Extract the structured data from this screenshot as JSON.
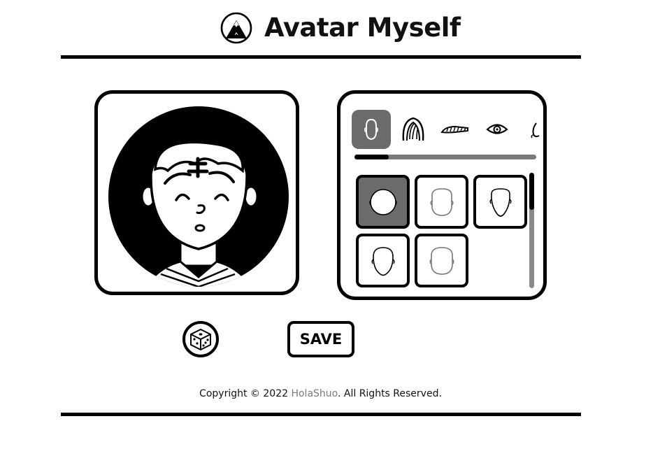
{
  "header": {
    "title": "Avatar Myself",
    "logo_icon": "mountain-logo-icon"
  },
  "avatar_preview": {
    "hair_color": "#000000",
    "face_icon": "avatar-face-icon"
  },
  "editor": {
    "categories": [
      {
        "name": "face",
        "icon": "face-shape-icon",
        "active": true
      },
      {
        "name": "hair",
        "icon": "hair-icon",
        "active": false
      },
      {
        "name": "eyebrows",
        "icon": "eyebrows-icon",
        "active": false
      },
      {
        "name": "eyes",
        "icon": "eye-icon",
        "active": false
      },
      {
        "name": "nose",
        "icon": "nose-icon",
        "active": false
      }
    ],
    "category_scroll_fraction": 0.19,
    "options": [
      {
        "name": "face-1",
        "selected": true
      },
      {
        "name": "face-2",
        "selected": false
      },
      {
        "name": "face-3",
        "selected": false
      },
      {
        "name": "face-4",
        "selected": false
      },
      {
        "name": "face-5",
        "selected": false
      }
    ],
    "options_scroll_fraction": 0.32
  },
  "actions": {
    "randomize_icon": "dice-icon",
    "save_label": "SAVE"
  },
  "footer": {
    "copyright_prefix": "Copyright © 2022 ",
    "brand": "HolaShuo",
    "copyright_suffix": ". All Rights Reserved."
  },
  "colors": {
    "ink": "#000000",
    "active_tile": "#6b6b6b",
    "brand_link": "#7b7b7b",
    "track": "#7a7a7a"
  }
}
